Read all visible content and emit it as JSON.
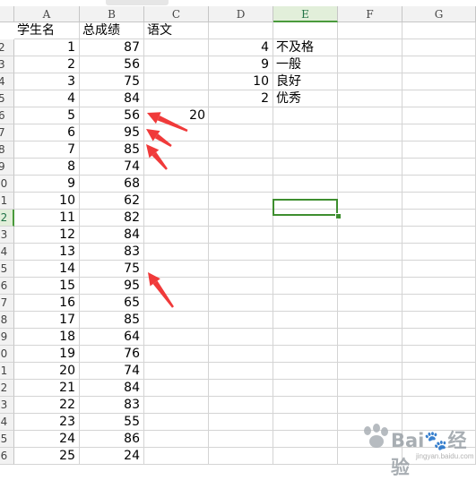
{
  "columns": [
    "A",
    "B",
    "C",
    "D",
    "E",
    "F",
    "G"
  ],
  "row_numbers": [
    "2",
    "3",
    "4",
    "5",
    "6",
    "7",
    "8",
    "9",
    "10",
    "11",
    "12",
    "13",
    "14",
    "15",
    "16",
    "17",
    "18",
    "19",
    "20",
    "21",
    "22",
    "23",
    "24",
    "25",
    "26"
  ],
  "header_row": {
    "A": "学生名",
    "B": "总成绩",
    "C": "语文"
  },
  "table": {
    "student_ids": [
      "1",
      "2",
      "3",
      "4",
      "5",
      "6",
      "7",
      "8",
      "9",
      "10",
      "11",
      "12",
      "13",
      "14",
      "15",
      "16",
      "17",
      "18",
      "19",
      "20",
      "21",
      "22",
      "23",
      "24",
      "25"
    ],
    "scores": [
      "87",
      "56",
      "75",
      "84",
      "56",
      "95",
      "85",
      "74",
      "68",
      "62",
      "82",
      "84",
      "83",
      "75",
      "95",
      "65",
      "85",
      "64",
      "76",
      "74",
      "84",
      "83",
      "55",
      "86",
      "24"
    ]
  },
  "summary": [
    {
      "count": "4",
      "label": "不及格"
    },
    {
      "count": "9",
      "label": "一般"
    },
    {
      "count": "10",
      "label": "良好"
    },
    {
      "count": "2",
      "label": "优秀"
    }
  ],
  "stray_value": "20",
  "active_cell": {
    "column": "E",
    "row": "12"
  },
  "annotations": {
    "arrow_color": "#f03a3a",
    "arrow_count": 4
  },
  "watermark": {
    "text": "Bai🐾经验",
    "sub": "jingyan.baidu.com"
  },
  "colors": {
    "header_bg": "#f2f2f2",
    "grid": "#d4d4d4",
    "selection": "#3e8e2f",
    "active_header_bg": "#e2efda"
  }
}
